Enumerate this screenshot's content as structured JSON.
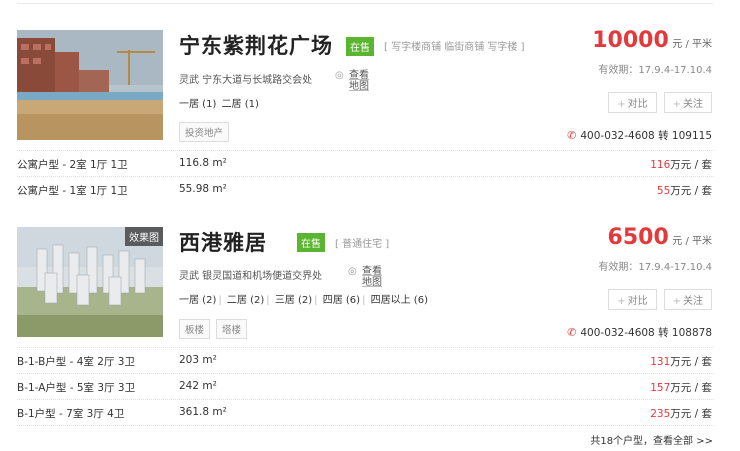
{
  "listings": [
    {
      "title": "宁东紫荆花广场",
      "status": "在售",
      "category": "[ 写字楼商铺 临街商铺 写字楼 ]",
      "address": "灵武 宁东大道与长城路交会处",
      "map_link": "查看地图",
      "rooms": [
        "一居 (1)",
        "二居 (1)"
      ],
      "tags": [
        "投资地产"
      ],
      "price": "10000",
      "price_unit": "元 / 平米",
      "validity": "有效期：17.9.4-17.10.4",
      "compare": "对比",
      "follow": "关注",
      "phone": "400-032-4608 转 109115",
      "units": [
        {
          "type": "公寓户型 - 2室 1厅 1卫",
          "area": "116.8 m²",
          "price": "116",
          "price_unit": "万元 / 套"
        },
        {
          "type": "公寓户型 - 1室 1厅 1卫",
          "area": "55.98 m²",
          "price": "55",
          "price_unit": "万元 / 套"
        }
      ]
    },
    {
      "title": "西港雅居",
      "status": "在售",
      "category": "[ 普通住宅 ]",
      "thumb_label": "效果图",
      "address": "灵武 银灵国道和机场便道交界处",
      "map_link": "查看地图",
      "rooms": [
        "一居 (2)",
        "二居 (2)",
        "三居 (2)",
        "四居 (6)",
        "四居以上 (6)"
      ],
      "tags": [
        "板楼",
        "塔楼"
      ],
      "price": "6500",
      "price_unit": "元 / 平米",
      "validity": "有效期：17.9.4-17.10.4",
      "compare": "对比",
      "follow": "关注",
      "phone": "400-032-4608 转 108878",
      "units": [
        {
          "type": "B-1-B户型 - 4室 2厅 3卫",
          "area": "203 m²",
          "price": "131",
          "price_unit": "万元 / 套"
        },
        {
          "type": "B-1-A户型 - 5室 3厅 3卫",
          "area": "242 m²",
          "price": "157",
          "price_unit": "万元 / 套"
        },
        {
          "type": "B-1户型 - 7室 3厅 4卫",
          "area": "361.8 m²",
          "price": "235",
          "price_unit": "万元 / 套"
        }
      ],
      "more": "共18个户型，查看全部 >>"
    }
  ],
  "icons": {
    "phone": "phone-icon",
    "location": "location-pin-icon",
    "plus": "plus-icon"
  },
  "colors": {
    "price": "#e4393c",
    "status_badge": "#5cb531"
  }
}
